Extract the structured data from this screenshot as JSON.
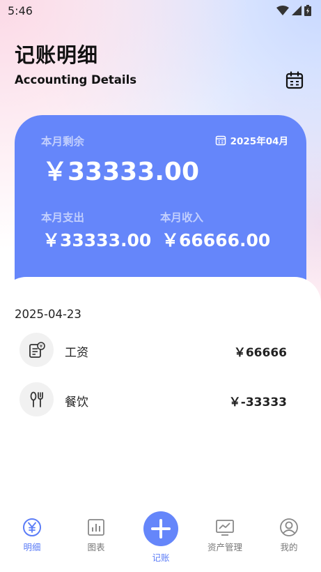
{
  "status_bar": {
    "time": "5:46"
  },
  "header": {
    "title_zh": "记账明细",
    "title_en": "Accounting Details"
  },
  "summary": {
    "remain_label": "本月剩余",
    "month": "2025年04月",
    "remain_value": "￥33333.00",
    "expense_label": "本月支出",
    "expense_value": "￥33333.00",
    "income_label": "本月收入",
    "income_value": "￥66666.00"
  },
  "records": {
    "date": "2025-04-23",
    "items": [
      {
        "name": "工资",
        "amount": "￥66666",
        "icon": "salary-icon"
      },
      {
        "name": "餐饮",
        "amount": "￥-33333",
        "icon": "dining-icon"
      }
    ]
  },
  "tabbar": {
    "tabs": [
      {
        "label": "明细",
        "icon": "yen-icon",
        "active": true
      },
      {
        "label": "图表",
        "icon": "chart-icon",
        "active": false
      },
      {
        "label": "记账",
        "icon": "plus-icon",
        "active": false
      },
      {
        "label": "资产管理",
        "icon": "asset-icon",
        "active": false
      },
      {
        "label": "我的",
        "icon": "profile-icon",
        "active": false
      }
    ]
  },
  "colors": {
    "accent": "#6586fa",
    "active_tab": "#5b7cf7"
  }
}
